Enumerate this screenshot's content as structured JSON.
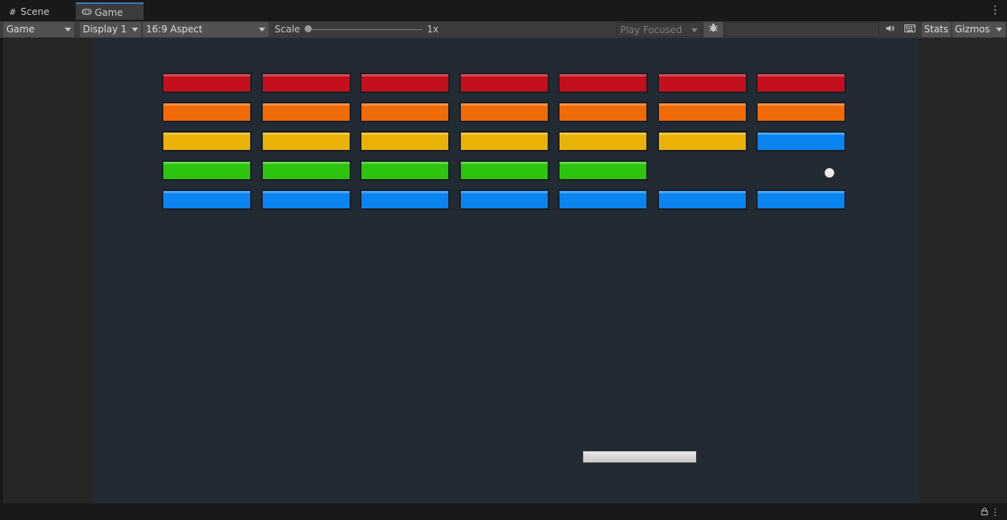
{
  "tabs": [
    {
      "label": "Scene",
      "icon": "grid-icon",
      "active": false
    },
    {
      "label": "Game",
      "icon": "gamepad-icon",
      "active": true
    }
  ],
  "toolbar": {
    "view_mode": "Game",
    "display": "Display 1",
    "aspect": "16:9 Aspect",
    "scale_label": "Scale",
    "scale_value": "1x",
    "play_mode": "Play Focused",
    "stats_label": "Stats",
    "gizmos_label": "Gizmos"
  },
  "game": {
    "background": "#222a33",
    "brick_colors": {
      "red": "#c40f1c",
      "orange": "#f06a06",
      "yellow": "#eab106",
      "green": "#2cc40d",
      "blue": "#0a84f0"
    },
    "rows": [
      [
        "red",
        "red",
        "red",
        "red",
        "red",
        "red",
        "red"
      ],
      [
        "orange",
        "orange",
        "orange",
        "orange",
        "orange",
        "orange",
        "orange"
      ],
      [
        "yellow",
        "yellow",
        "yellow",
        "yellow",
        "yellow",
        "yellow",
        "blue"
      ],
      [
        "green",
        "green",
        "green",
        "green",
        "green",
        "",
        ""
      ],
      [
        "blue",
        "blue",
        "blue",
        "blue",
        "blue",
        "blue",
        "blue"
      ]
    ]
  }
}
